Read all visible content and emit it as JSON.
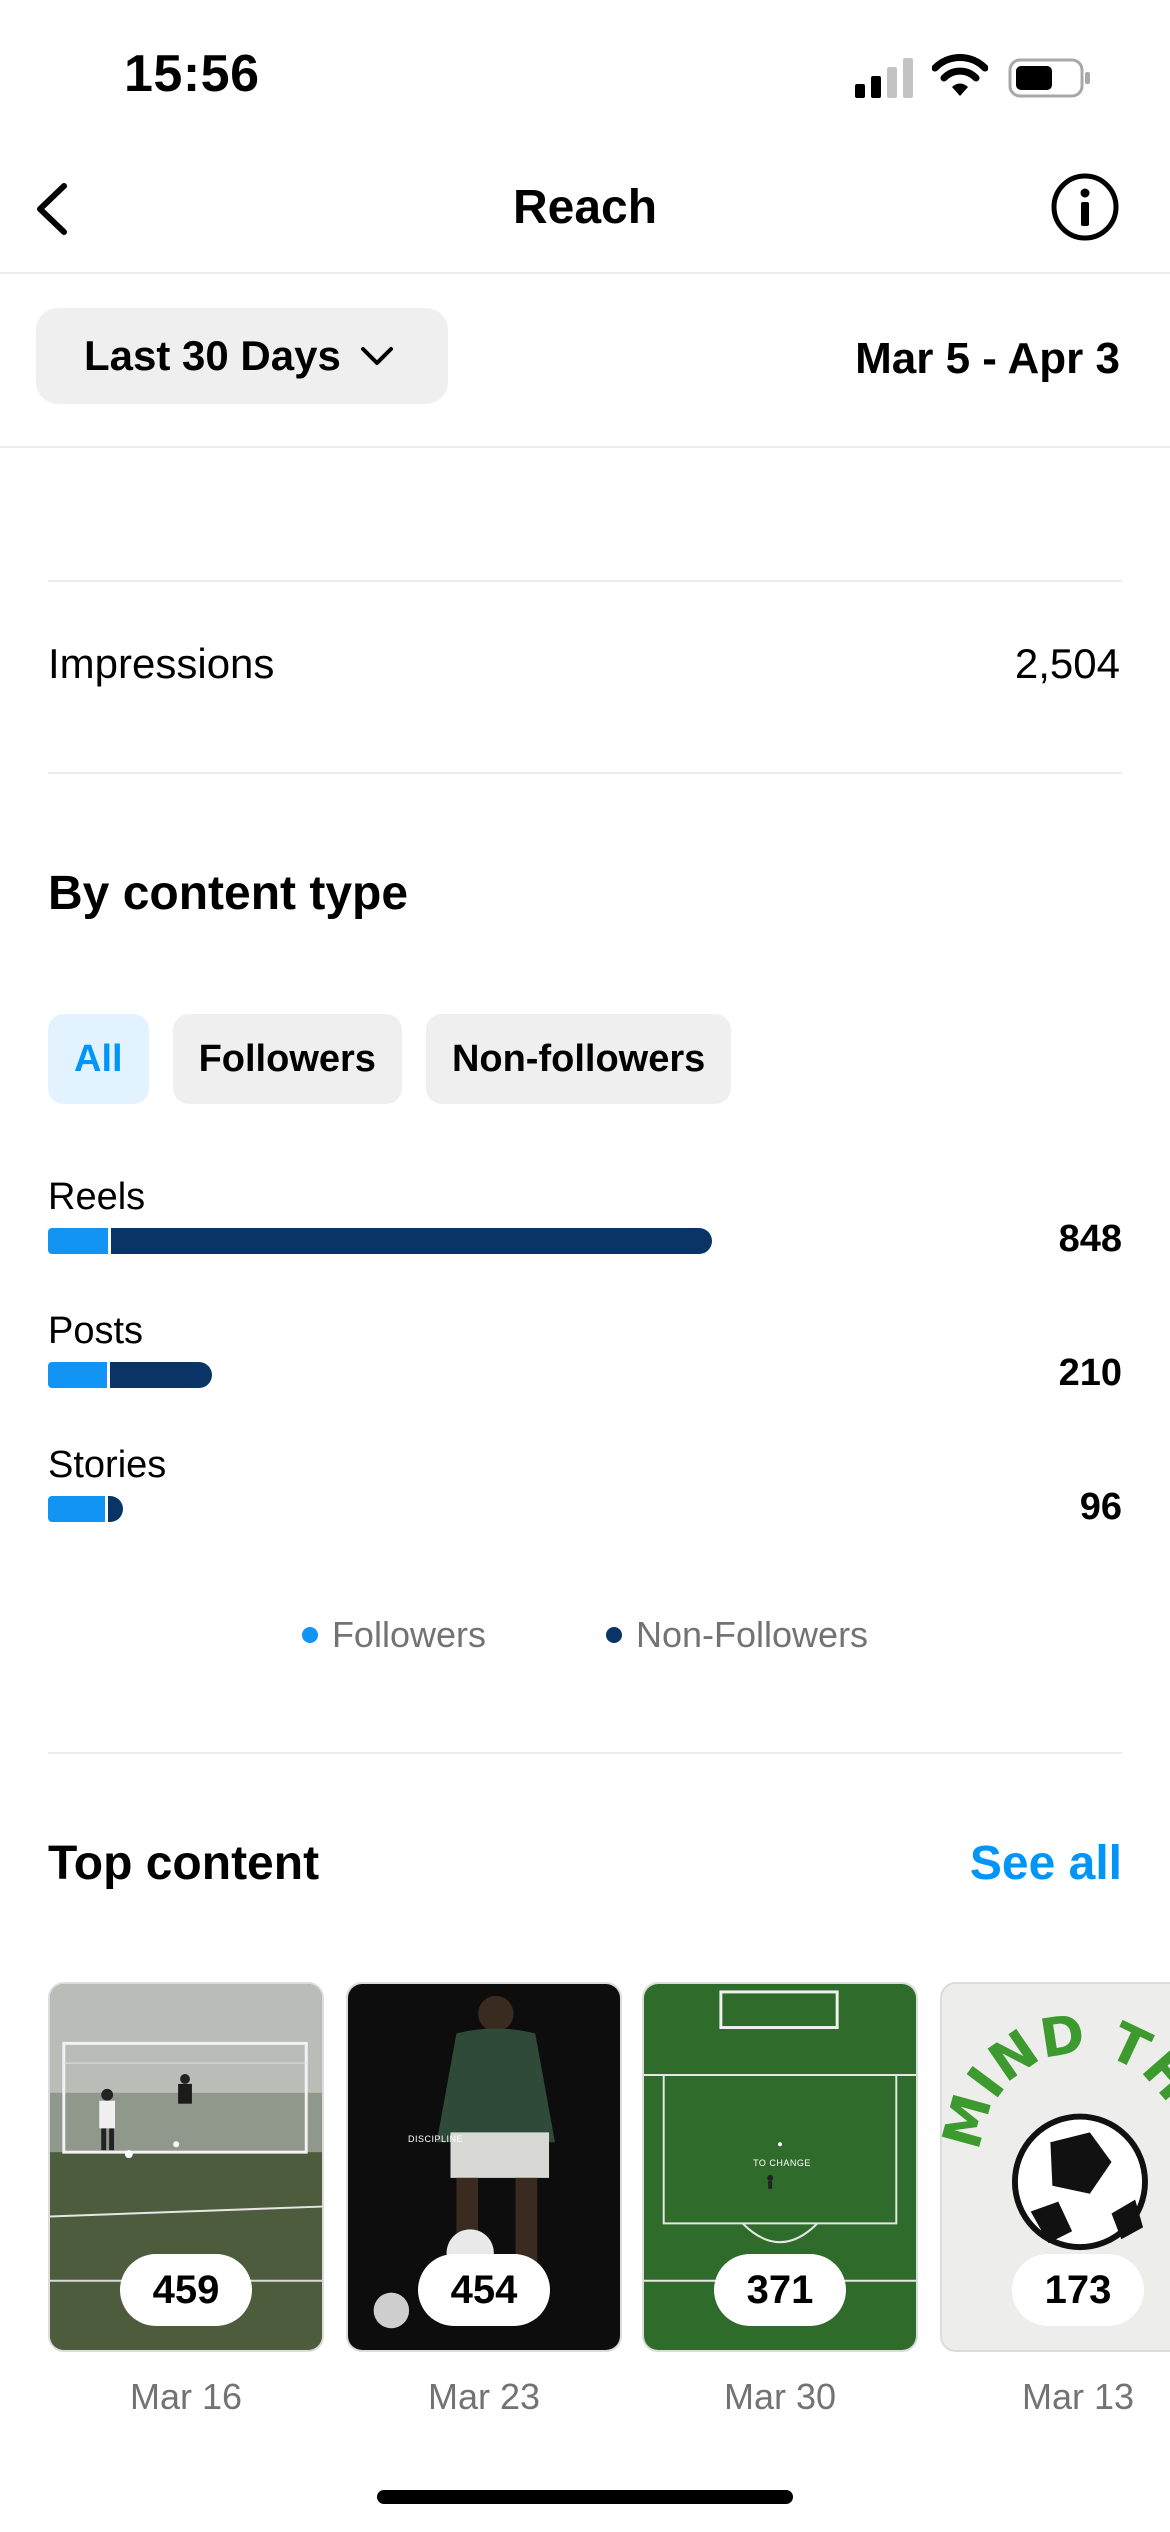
{
  "status_bar": {
    "time": "15:56"
  },
  "nav": {
    "title": "Reach"
  },
  "filter": {
    "range_label": "Last 30 Days",
    "date_range": "Mar 5 - Apr 3"
  },
  "impressions": {
    "label": "Impressions",
    "value": "2,504"
  },
  "by_content_type": {
    "title": "By content type",
    "chips": [
      {
        "label": "All",
        "selected": true
      },
      {
        "label": "Followers",
        "selected": false
      },
      {
        "label": "Non-followers",
        "selected": false
      }
    ],
    "rows": [
      {
        "label": "Reels",
        "value": "848",
        "followers_fraction": 0.09
      },
      {
        "label": "Posts",
        "value": "210",
        "followers_fraction": 0.36
      },
      {
        "label": "Stories",
        "value": "96",
        "followers_fraction": 0.76
      }
    ],
    "legend": [
      {
        "label": "Followers",
        "color": "#1294f5"
      },
      {
        "label": "Non-Followers",
        "color": "#0a3466"
      }
    ]
  },
  "top_content": {
    "title": "Top content",
    "see_all": "See all",
    "items": [
      {
        "count": "459",
        "date": "Mar 16"
      },
      {
        "count": "454",
        "date": "Mar 23",
        "overlay_text": "DISCIPLINE"
      },
      {
        "count": "371",
        "date": "Mar 30",
        "overlay_text": "TO CHANGE"
      },
      {
        "count": "173",
        "date": "Mar 13",
        "overlay_text": "MIND THE BALL"
      }
    ]
  },
  "colors": {
    "accent": "#0095f6",
    "followers": "#1294f5",
    "non_followers": "#0a3466"
  }
}
